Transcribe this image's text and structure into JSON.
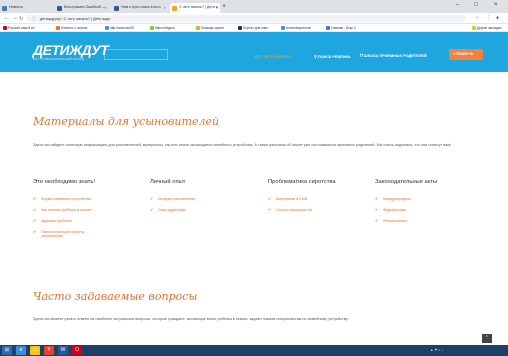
{
  "browser": {
    "tabs": [
      {
        "label": "Новость",
        "color": "#4a76c7"
      },
      {
        "label": "Бесстрашно Ошибкой —",
        "color": "#3b5998"
      },
      {
        "label": "Нам о путь поиск в кото",
        "color": "#3b5998"
      },
      {
        "label": "С чего начать? | Дети ж",
        "color": "#f5a623"
      }
    ],
    "url": "детижду.рф / С чего начать? | Дети ждут",
    "bookmarks": [
      {
        "label": "Русский язык 8 кл",
        "color": "#d0021b"
      },
      {
        "label": "Новости с острые",
        "color": "#e8712a"
      },
      {
        "label": "http://www.dud/S",
        "color": "#4a90e2"
      },
      {
        "label": "https://istgoroi",
        "color": "#7ed321"
      },
      {
        "label": "Помощь сироте",
        "color": "#f5a623"
      },
      {
        "label": "Портал для опек",
        "color": "#333333"
      },
      {
        "label": "Благотворительн",
        "color": "#4a90e2"
      },
      {
        "label": "Главная - Боку С",
        "color": "#4a76c7"
      },
      {
        "label": "Другие закладки",
        "color": "#f5c518"
      }
    ]
  },
  "header": {
    "logo": "ДЕТИЖДУТ",
    "logo_sub": "БЛАГОТВОРИТЕЛЬНЫЙ ФОНД",
    "nav": [
      {
        "label": "С ЧЕГО НАЧАТЬ?",
        "style": "orange"
      },
      {
        "label": "ПОИСК РЕБЁНКА",
        "style": "white"
      },
      {
        "label": "ШКОЛА ПРИЕМНЫХ РОДИТЕЛЕЙ",
        "style": "white"
      }
    ],
    "help_button": "ПОМОЧЬ"
  },
  "materials": {
    "title": "Материалы для усыновителей",
    "intro": "Здесь вы найдете полезную информацию для усыновителей, материалы, так или иначе касающиеся семейного устройства. А также рассказы об опыте уже состоявшихся приемных родителей. Мы очень надеемся, что они помогут вам!",
    "columns": [
      {
        "title": "Это необходимо знать!",
        "items": [
          "Формы семейного устройства",
          "Как принять ребёнка в семью?",
          "Здоровье ребёнка",
          "Психологические аспекты усыновления"
        ]
      },
      {
        "title": "Личный опыт",
        "items": [
          "Истории усыновления",
          "Опыт адаптации"
        ]
      },
      {
        "title": "Проблематика сиротства",
        "items": [
          "Материалы в СМИ",
          "Статьи специалистов"
        ]
      },
      {
        "title": "Законодательные акты",
        "items": [
          "Международные",
          "Федеральные",
          "Региональные"
        ]
      }
    ]
  },
  "faq": {
    "title": "Часто задаваемые вопросы",
    "intro": "Здесь вы можете узнать ответы на наиболее актуальные вопросы, которые граждане, желающие взять ребенка в семью, задают нашим специалистам по семейному устройству."
  },
  "colors": {
    "accent": "#e8712a",
    "header": "#1fa6de",
    "help": "#f5823c"
  }
}
